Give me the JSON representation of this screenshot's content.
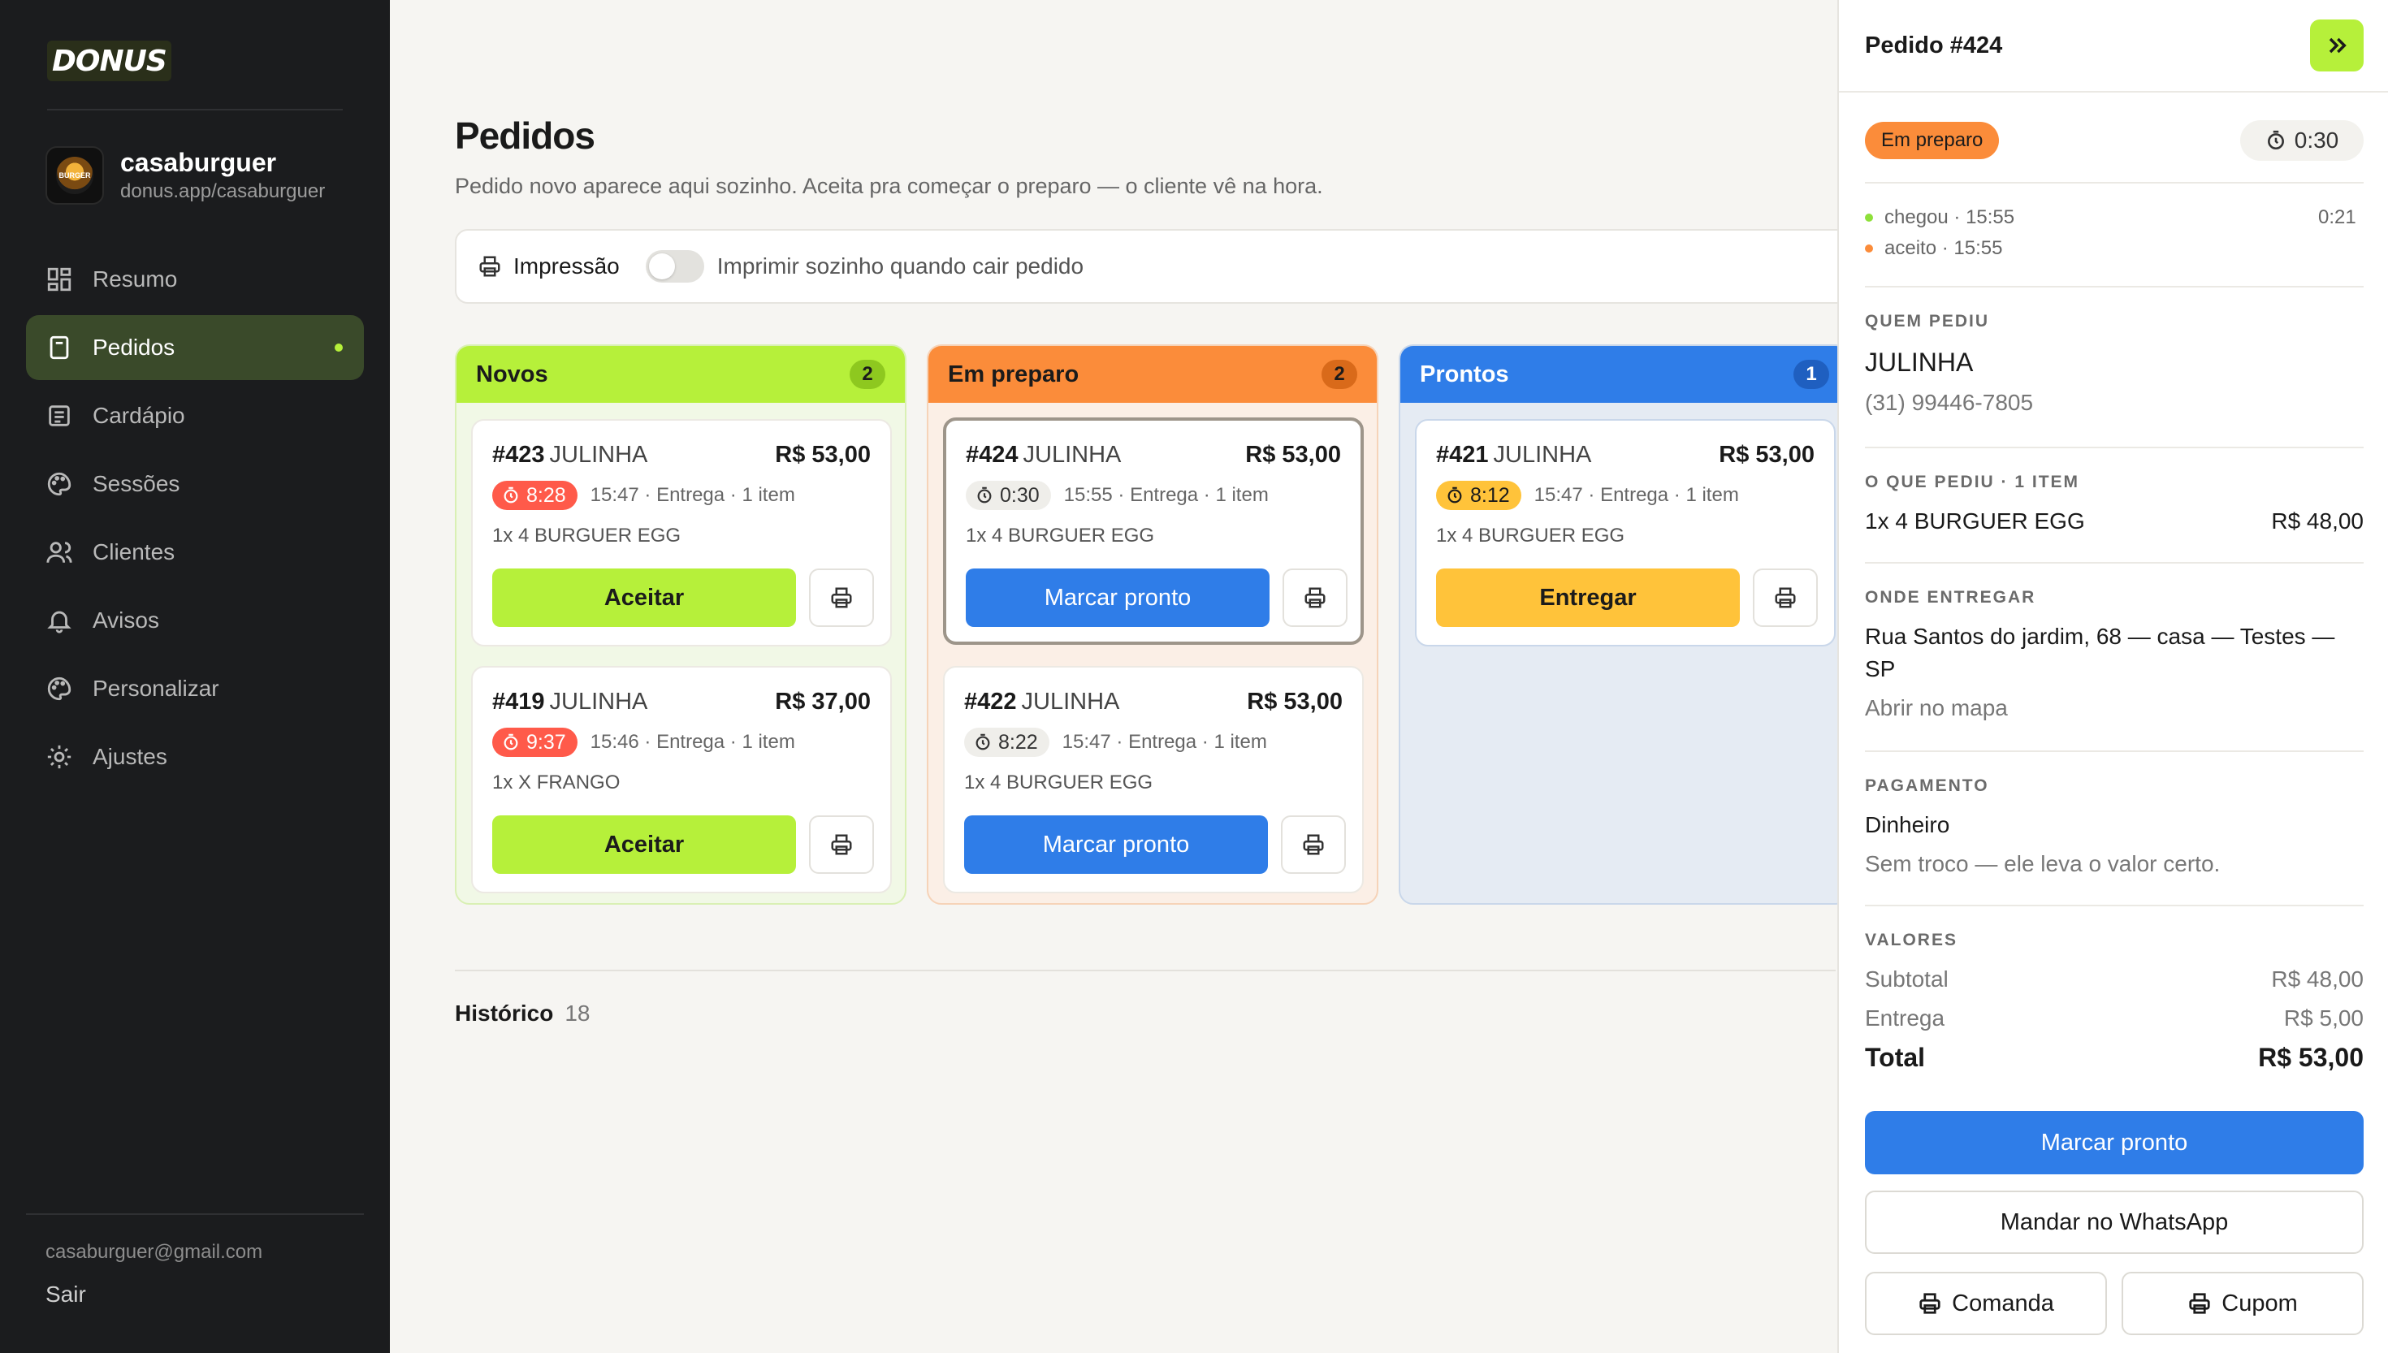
{
  "app": {
    "logo_text": "DONUS",
    "brand_color": "#b6f03a"
  },
  "store": {
    "name": "casaburguer",
    "url": "donus.app/casaburguer",
    "avatar_text": "BURGER"
  },
  "nav": [
    {
      "label": "Resumo",
      "icon": "dashboard-icon"
    },
    {
      "label": "Pedidos",
      "icon": "receipt-icon",
      "active": true
    },
    {
      "label": "Cardápio",
      "icon": "menu-icon"
    },
    {
      "label": "Sessões",
      "icon": "palette-icon"
    },
    {
      "label": "Clientes",
      "icon": "users-icon"
    },
    {
      "label": "Avisos",
      "icon": "bell-icon"
    },
    {
      "label": "Personalizar",
      "icon": "palette-icon"
    },
    {
      "label": "Ajustes",
      "icon": "gear-icon"
    }
  ],
  "account": {
    "email": "casaburguer@gmail.com",
    "logout": "Sair"
  },
  "page": {
    "title": "Pedidos",
    "subtitle": "Pedido novo aparece aqui sozinho. Aceita pra começar o preparo — o cliente vê na hora."
  },
  "printing": {
    "label": "Impressão",
    "auto_print_label": "Imprimir sozinho quando cair pedido",
    "enabled": false
  },
  "columns": {
    "novos": {
      "title": "Novos",
      "count": "2",
      "cards": [
        {
          "number": "#423",
          "customer": "JULINHA",
          "price": "R$ 53,00",
          "timer": "8:28",
          "time": "15:47",
          "meta": "· Entrega · 1 item",
          "items": "1x 4 BURGUER EGG",
          "action": "Aceitar"
        },
        {
          "number": "#419",
          "customer": "JULINHA",
          "price": "R$ 37,00",
          "timer": "9:37",
          "time": "15:46",
          "meta": "· Entrega · 1 item",
          "items": "1x X FRANGO",
          "action": "Aceitar"
        }
      ]
    },
    "preparo": {
      "title": "Em preparo",
      "count": "2",
      "cards": [
        {
          "number": "#424",
          "customer": "JULINHA",
          "price": "R$ 53,00",
          "timer": "0:30",
          "time": "15:55",
          "meta": "· Entrega · 1 item",
          "items": "1x 4 BURGUER EGG",
          "action": "Marcar pronto"
        },
        {
          "number": "#422",
          "customer": "JULINHA",
          "price": "R$ 53,00",
          "timer": "8:22",
          "time": "15:47",
          "meta": "· Entrega · 1 item",
          "items": "1x 4 BURGUER EGG",
          "action": "Marcar pronto"
        }
      ]
    },
    "prontos": {
      "title": "Prontos",
      "count": "1",
      "cards": [
        {
          "number": "#421",
          "customer": "JULINHA",
          "price": "R$ 53,00",
          "timer": "8:12",
          "time": "15:47",
          "meta": "· Entrega · 1 item",
          "items": "1x 4 BURGUER EGG",
          "action": "Entregar"
        }
      ]
    }
  },
  "history": {
    "label": "Histórico",
    "count": "18"
  },
  "detail": {
    "title": "Pedido #424",
    "status": "Em preparo",
    "timer": "0:30",
    "timeline": [
      {
        "label": "chegou · 15:55",
        "color": "#8ee03a"
      },
      {
        "label": "aceito · 15:55",
        "color": "#fb8c3a"
      }
    ],
    "timeline_elapsed": "0:21",
    "customer_label": "QUEM PEDIU",
    "customer_name": "JULINHA",
    "customer_phone": "(31) 99446-7805",
    "items_label": "O QUE PEDIU · 1 ITEM",
    "items": [
      {
        "name": "1x 4 BURGUER EGG",
        "price": "R$ 48,00"
      }
    ],
    "delivery_label": "ONDE ENTREGAR",
    "address_line1": "Rua Santos do jardim, 68 — casa — Testes —",
    "address_line2": "SP",
    "map_link": "Abrir no mapa",
    "payment_label": "PAGAMENTO",
    "payment_method": "Dinheiro",
    "payment_note": "Sem troco — ele leva o valor certo.",
    "values_label": "VALORES",
    "subtotal_label": "Subtotal",
    "subtotal": "R$ 48,00",
    "delivery_fee_label": "Entrega",
    "delivery_fee": "R$ 5,00",
    "total_label": "Total",
    "total": "R$ 53,00",
    "primary_action": "Marcar pronto",
    "whatsapp_action": "Mandar no WhatsApp",
    "comanda_action": "Comanda",
    "cupom_action": "Cupom"
  }
}
